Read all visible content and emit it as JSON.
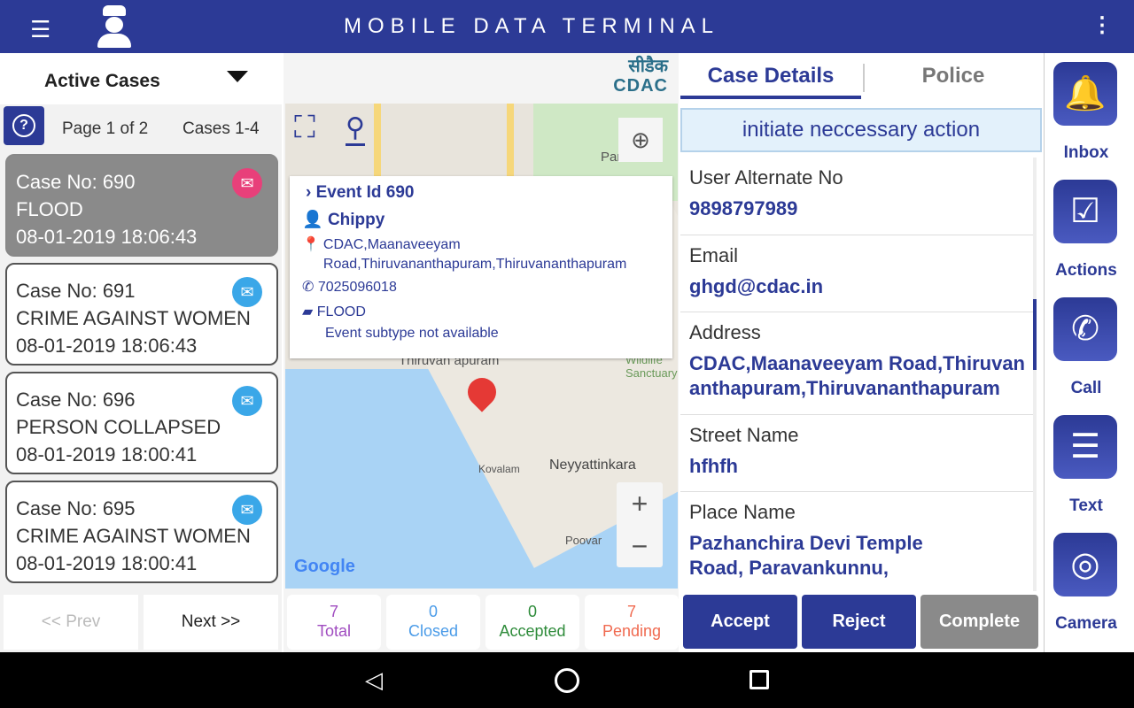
{
  "app": {
    "title": "MOBILE DATA TERMINAL",
    "colors": {
      "primary": "#2c3a96",
      "selected_card": "#8a8a8a"
    }
  },
  "left": {
    "dropdown": "Active Cases",
    "page": "Page 1 of 2",
    "cases": "Cases 1-4",
    "help_icon": "?",
    "cards": [
      {
        "case": "Case No: 690",
        "type": "FLOOD",
        "time": "08-01-2019 18:06:43",
        "status": "opened"
      },
      {
        "case": "Case No: 691",
        "type": "CRIME AGAINST WOMEN",
        "time": "08-01-2019 18:06:43",
        "status": "unread"
      },
      {
        "case": "Case No: 696",
        "type": "PERSON COLLAPSED",
        "time": "08-01-2019 18:00:41",
        "status": "unread"
      },
      {
        "case": "Case No: 695",
        "type": "CRIME AGAINST WOMEN",
        "time": "08-01-2019 18:00:41",
        "status": "unread"
      }
    ],
    "prev": "<< Prev",
    "next": "Next >>"
  },
  "map": {
    "logo_hindi": "सीडैक",
    "logo": "CDAC",
    "labels": [
      "Par",
      "Thiruvan   apuram",
      "Wildlife Sanctuary",
      "Kovalam",
      "Neyyattinkara",
      "Poovar"
    ],
    "google": "Google",
    "popup": {
      "event": "Event Id 690",
      "name": "Chippy",
      "address": "CDAC,Maanaveeyam Road,Thiruvananthapuram,Thiruvananthapuram",
      "phone": "7025096018",
      "type": "FLOOD",
      "subtype": "Event subtype not available"
    },
    "zoom_in": "+",
    "zoom_out": "−"
  },
  "stats": [
    {
      "value": "7",
      "label": "Total",
      "color": "#a04cc0"
    },
    {
      "value": "0",
      "label": "Closed",
      "color": "#4a9be8"
    },
    {
      "value": "0",
      "label": "Accepted",
      "color": "#2e8b3a"
    },
    {
      "value": "7",
      "label": "Pending",
      "color": "#f06a50"
    }
  ],
  "details": {
    "tabs": [
      "Case Details",
      "Police"
    ],
    "banner": "initiate neccessary action",
    "fields": [
      {
        "label": "User Alternate No",
        "value": "9898797989"
      },
      {
        "label": "Email",
        "value": "ghgd@cdac.in"
      },
      {
        "label": "Address",
        "value": "CDAC,Maanaveeyam Road,Thiruvananthapuram,Thiruvananthapuram"
      },
      {
        "label": "Street Name",
        "value": "hfhfh"
      },
      {
        "label": "Place Name",
        "value": "Pazhanchira Devi Temple Road, Paravankunnu,"
      }
    ],
    "accept": "Accept",
    "reject": "Reject",
    "complete": "Complete"
  },
  "side": [
    {
      "label": "Inbox",
      "icon": "🔔"
    },
    {
      "label": "Actions",
      "icon": "☑"
    },
    {
      "label": "Call",
      "icon": "✆"
    },
    {
      "label": "Text",
      "icon": "☰"
    },
    {
      "label": "Camera",
      "icon": "◎"
    }
  ]
}
